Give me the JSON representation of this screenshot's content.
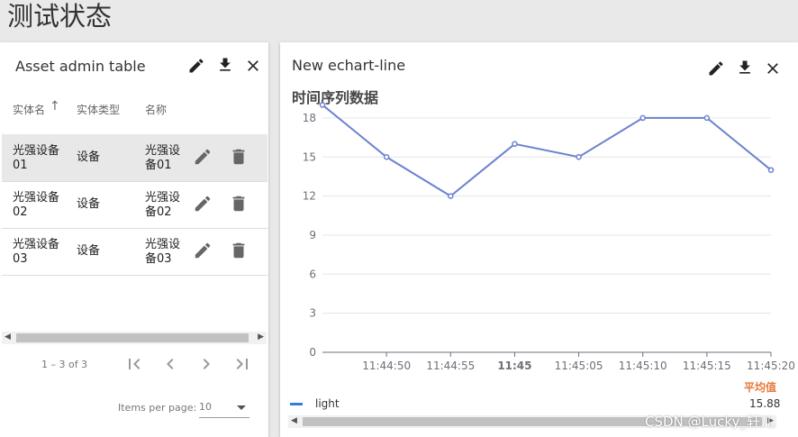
{
  "page": {
    "title": "测试状态"
  },
  "asset_table": {
    "title": "Asset admin table",
    "columns": [
      "实体名",
      "实体类型",
      "名称"
    ],
    "rows": [
      {
        "entity_name": "光强设备\n01",
        "entity_type": "设备",
        "name": "光强设\n备01",
        "selected": true
      },
      {
        "entity_name": "光强设备\n02",
        "entity_type": "设备",
        "name": "光强设\n备02",
        "selected": false
      },
      {
        "entity_name": "光强设备\n03",
        "entity_type": "设备",
        "name": "光强设\n备03",
        "selected": false
      }
    ],
    "pagination": {
      "range": "1 – 3 of 3",
      "items_per_page_label": "Items per page:",
      "items_per_page": "10"
    }
  },
  "chart_card": {
    "title": "New echart-line",
    "avg_label": "平均值",
    "legend": [
      {
        "name": "light",
        "value": "15.88",
        "color": "#2f7de1"
      }
    ]
  },
  "chart_data": {
    "type": "line",
    "title": "时间序列数据",
    "x": [
      "11:44:45",
      "11:44:50",
      "11:44:55",
      "11:45:00",
      "11:45:05",
      "11:45:10",
      "11:45:15",
      "11:45:20"
    ],
    "x_tick_labels": [
      "11:44:50",
      "11:44:55",
      "11:45",
      "11:45:05",
      "11:45:10",
      "11:45:15",
      "11:45:20"
    ],
    "series": [
      {
        "name": "light",
        "values": [
          19,
          15,
          12,
          16,
          15,
          18,
          18,
          14
        ],
        "color": "#6b82cf"
      }
    ],
    "y_ticks": [
      0,
      3,
      6,
      9,
      12,
      15,
      18
    ],
    "ylim": [
      0,
      20
    ],
    "grid": true
  },
  "watermark": "CSDN @Lucky_轩儿",
  "icons": {
    "edit": "edit-icon",
    "download": "download-icon",
    "close": "close-icon",
    "delete": "delete-icon",
    "first": "first-page-icon",
    "prev": "prev-page-icon",
    "next": "next-page-icon",
    "last": "last-page-icon"
  }
}
